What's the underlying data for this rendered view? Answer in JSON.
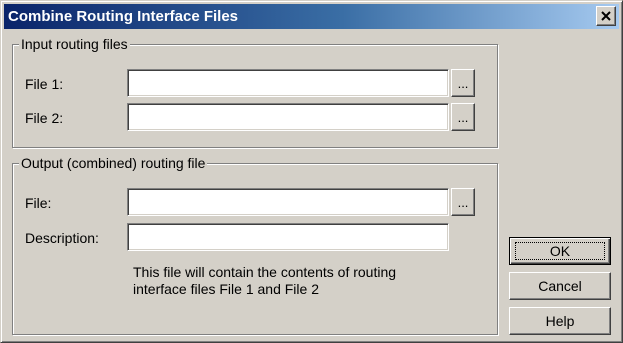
{
  "window": {
    "title": "Combine Routing Interface Files"
  },
  "input_group": {
    "legend": "Input routing files",
    "file1_label": "File 1:",
    "file1_value": "",
    "file2_label": "File 2:",
    "file2_value": "",
    "browse_label": "..."
  },
  "output_group": {
    "legend": "Output (combined) routing file",
    "file_label": "File:",
    "file_value": "",
    "description_label": "Description:",
    "description_value": "",
    "browse_label": "...",
    "note_line1": "This file will contain the contents of routing",
    "note_line2": "interface files File 1 and File 2"
  },
  "buttons": {
    "ok": "OK",
    "cancel": "Cancel",
    "help": "Help"
  },
  "icons": {
    "close": "close-icon"
  },
  "colors": {
    "title_gradient_start": "#0a246a",
    "title_gradient_end": "#a6caf0",
    "face": "#d4d0c8"
  }
}
